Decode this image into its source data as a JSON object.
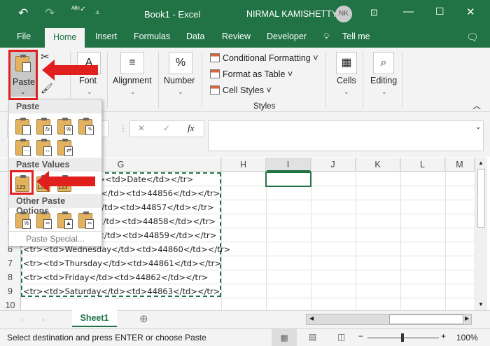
{
  "title_bar": {
    "doc_title": "Book1  -  Excel",
    "user_name": "NIRMAL KAMISHETTY",
    "user_initials": "NK",
    "colors": {
      "brand": "#217346"
    }
  },
  "tabs": [
    "File",
    "Home",
    "Insert",
    "Formulas",
    "Data",
    "Review",
    "Developer",
    "Tell me"
  ],
  "ribbon": {
    "paste": "Paste",
    "font": "Font",
    "alignment": "Alignment",
    "number": "Number",
    "number_icon": "%",
    "conditional_formatting": "Conditional Formatting",
    "format_as_table": "Format as Table",
    "cell_styles": "Cell Styles",
    "styles_group": "Styles",
    "cells": "Cells",
    "editing": "Editing"
  },
  "formula_bar": {
    "cancel": "✕",
    "enter": "✓",
    "fx": "fx"
  },
  "paste_menu": {
    "paste_header": "Paste",
    "paste_values_header": "Paste Values",
    "other_header": "Other Paste Options",
    "paste_special": "Paste Special...",
    "value_icon_label": "123"
  },
  "columns": [
    "G",
    "H",
    "I",
    "J",
    "K",
    "L",
    "M"
  ],
  "rows": [
    {
      "n": "1",
      "g": "<tr><td>Day</td><td>Date</td></tr>"
    },
    {
      "n": "2",
      "g": "<tr><td>Saturday</td><td>44856</td></tr>"
    },
    {
      "n": "3",
      "g": "<tr><td>Sunday</td><td>44857</td></tr>"
    },
    {
      "n": "4",
      "g": "<tr><td>Monday</td><td>44858</td></tr>"
    },
    {
      "n": "5",
      "g": "<tr><td>Tuesday</td><td>44859</td></tr>"
    },
    {
      "n": "6",
      "g": "<tr><td>Wednesday</td><td>44860</td></tr>"
    },
    {
      "n": "7",
      "g": "<tr><td>Thursday</td><td>44861</td></tr>"
    },
    {
      "n": "8",
      "g": "<tr><td>Friday</td><td>44862</td></tr>"
    },
    {
      "n": "9",
      "g": "<tr><td>Saturday</td><td>44863</td></tr>"
    },
    {
      "n": "10",
      "g": ""
    }
  ],
  "sheet_tabs": [
    "Sheet1"
  ],
  "status": {
    "message": "Select destination and press ENTER or choose Paste",
    "zoom": "100%"
  }
}
